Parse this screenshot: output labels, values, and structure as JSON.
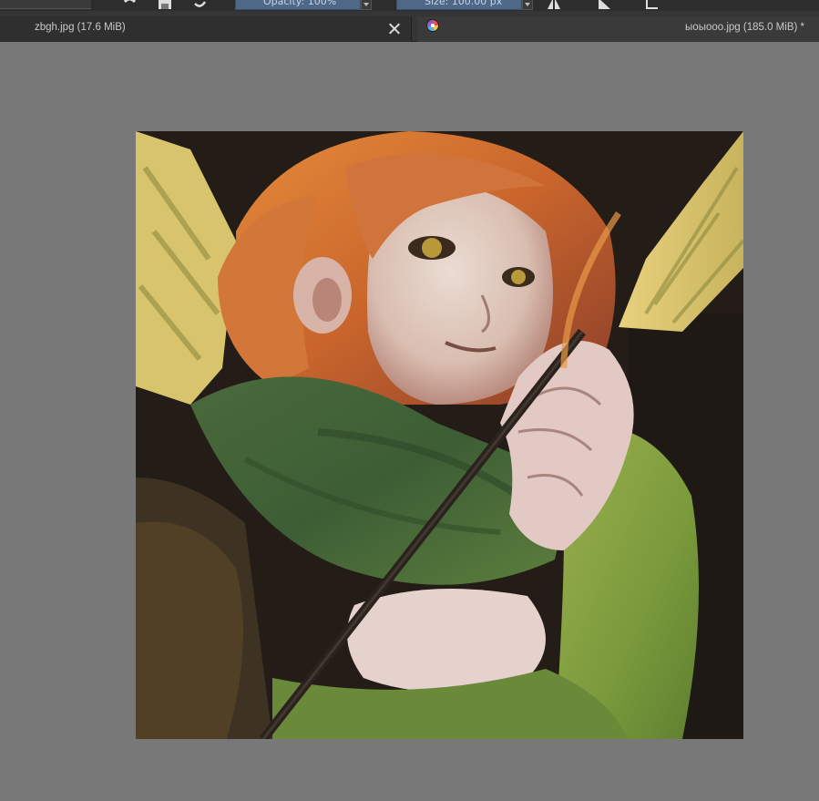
{
  "toolbar": {
    "opacity_label": "Opacity: 100%",
    "size_label": "Size: 100.00 px"
  },
  "tabs": [
    {
      "label": "zbgh.jpg (17.6 MiB)",
      "active": false
    },
    {
      "label": "ыоыооо.jpg (185.0 MiB) *",
      "active": true
    }
  ],
  "icons": {
    "toolbar": [
      "undo-icon",
      "save-icon",
      "redo-icon",
      "mirror-icon",
      "play-icon",
      "crop-icon"
    ],
    "tab_close": "close-icon",
    "tab_app": "app-logo-icon"
  },
  "canvas": {
    "background_color": "#787878",
    "artwork_subject": "painting of a red-haired woman in a green scarf holding an arrow"
  },
  "colors": {
    "field_blue": "#4f6888",
    "tabbar": "#353535"
  }
}
